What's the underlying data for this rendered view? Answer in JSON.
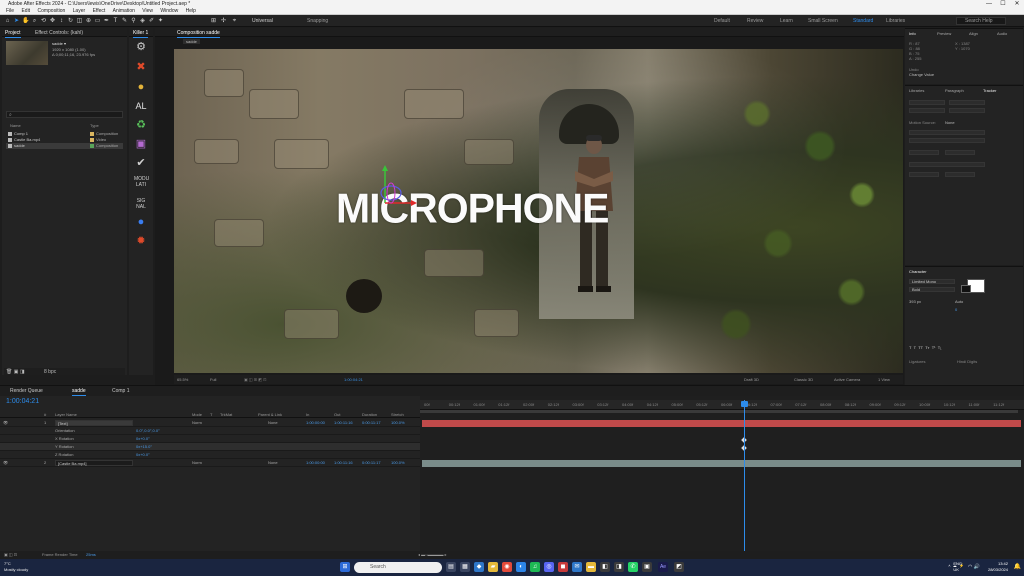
{
  "window": {
    "title": "Adobe After Effects 2024 - C:\\Users\\lewis\\OneDrive\\Desktop\\Untitled Project.aep *",
    "controls": [
      "—",
      "☐",
      "✕"
    ]
  },
  "menu": [
    "File",
    "Edit",
    "Composition",
    "Layer",
    "Effect",
    "Animation",
    "View",
    "Window",
    "Help"
  ],
  "toolbar": {
    "snapping_label": "Snapping",
    "universal_label": "Universal",
    "workspaces": [
      "Default",
      "Review",
      "Learn",
      "Small Screen",
      "Standard",
      "Libraries"
    ],
    "active_workspace": "Standard",
    "search_placeholder": "Search Help"
  },
  "project_panel": {
    "tab": "Project",
    "tab2": "Effect Controls: (kahl)",
    "comp_name": "sadde ▾",
    "comp_info_1": "1920 x 1080 (1.00)",
    "comp_info_2": "Δ 0;00;11;16, 23.976 fps",
    "search_placeholder": "⌕",
    "col_name": "Name",
    "col_label": "Type",
    "items": [
      {
        "name": "Comp 1",
        "label": "Composition",
        "color": "#d9b660"
      },
      {
        "name": "Castle Ba.mp4",
        "label": "Video",
        "color": "#d9b660"
      },
      {
        "name": "sadde",
        "label": "Composition",
        "color": "#5aa55a"
      }
    ],
    "footer_bpc": "8 bpc"
  },
  "effects_strip": {
    "title": "Killer 1",
    "icons": [
      {
        "name": "gear-icon",
        "glyph": "⚙",
        "color": "#cfcfcf"
      },
      {
        "name": "cross-arrows-icon",
        "glyph": "✖",
        "color": "#e04a2a"
      },
      {
        "name": "bulb-icon",
        "glyph": "💡",
        "color": "#e3b33a"
      },
      {
        "name": "al-text-icon",
        "glyph": "AL",
        "color": "#e0e0e0"
      },
      {
        "name": "recycle-icon",
        "glyph": "♻",
        "color": "#59c25b"
      },
      {
        "name": "calendar-icon",
        "glyph": "▣",
        "color": "#b46ad1"
      },
      {
        "name": "check-icon",
        "glyph": "✔",
        "color": "#d0d0d0"
      },
      {
        "name": "modulati-icon",
        "glyph": "MODU LATI",
        "color": "#d0d0d0"
      },
      {
        "name": "signal-icon",
        "glyph": "SIG NAL",
        "color": "#d0d0d0"
      },
      {
        "name": "circle-icon",
        "glyph": "●",
        "color": "#3a7df0"
      },
      {
        "name": "star-icon",
        "glyph": "✹",
        "color": "#e04a2a"
      }
    ]
  },
  "composition": {
    "tab_label": "Composition sadde",
    "breadcrumb": "sadde",
    "text_layer": "MICROPHONE",
    "footer": {
      "zoom": "65.5%",
      "resolution": "Full",
      "timecode": "1:00:04:21",
      "renderer": "Draft 3D",
      "camera": "Classic 3D",
      "view_mode": "Active Camera",
      "views": "1 View"
    }
  },
  "right_panels": {
    "info_tabs": [
      "Info",
      "Preview",
      "Align",
      "Audio"
    ],
    "info_r": "R : 87",
    "info_g": "G : 88",
    "info_b": "B : 75",
    "info_a": "A : 255",
    "info_x": "X : 1387",
    "info_y": "Y : 1070",
    "undo_label": "Undo",
    "undo_value": "Change Value",
    "tracker_tabs": [
      "Libraries",
      "Paragraph",
      "Tracker"
    ],
    "motion_source_label": "Motion Source:",
    "motion_source_value": "None",
    "character_tab": "Character",
    "font_name": "Limited Mono",
    "font_style": "Bold",
    "font_size": "393 px",
    "leading": "Auto",
    "tracking": "0",
    "ligatures_label": "Ligatures",
    "hindi_label": "Hindi Digits"
  },
  "timeline": {
    "tabs": [
      "Render Queue",
      "sadde",
      "Comp 1"
    ],
    "active_tab": "sadde",
    "timecode": "1:00:04:21",
    "columns": [
      "#",
      "Layer Name",
      "Mode",
      "T",
      "TrkMat",
      "Parent & Link",
      "In",
      "Out",
      "Duration",
      "Stretch"
    ],
    "layers": [
      {
        "num": "1",
        "name": "[Text]",
        "mode": "Norm",
        "parent": "None",
        "in": "1:00:00:00",
        "out": "1:00:11:16",
        "dur": "0:00:11:17",
        "stretch": "100.0%",
        "selected": true
      },
      {
        "num": "",
        "name": "Orientation",
        "value": "0.0°,0.0°,0.0°",
        "sub": true
      },
      {
        "num": "",
        "name": "X Rotation",
        "value": "0x+0.0°",
        "sub": true
      },
      {
        "num": "",
        "name": "Y Rotation",
        "value": "0x+15.0°",
        "sub": true,
        "selected": true
      },
      {
        "num": "",
        "name": "Z Rotation",
        "value": "0x+0.0°",
        "sub": true
      },
      {
        "num": "2",
        "name": "[Castle Ba.mp4]",
        "mode": "Norm",
        "parent": "None",
        "in": "1:00:00:00",
        "out": "1:00:11:16",
        "dur": "0:00:11:17",
        "stretch": "100.0%"
      }
    ],
    "ruler_ticks": [
      "00f",
      "00:12f",
      "01:00f",
      "01:12f",
      "02:00f",
      "02:12f",
      "03:00f",
      "03:12f",
      "04:00f",
      "04:12f",
      "05:00f",
      "05:12f",
      "06:00f",
      "06:12f",
      "07:00f",
      "07:12f",
      "08:00f",
      "08:12f",
      "09:00f",
      "09:12f",
      "10:00f",
      "10:12f",
      "11:00f",
      "11:12f"
    ],
    "footer_label": "Frame Render Time",
    "footer_value": "25ms",
    "colors": {
      "text_layer": "#c04a4a",
      "video_layer": "#7a8c8a",
      "playhead": "#2d8ceb"
    }
  },
  "taskbar": {
    "weather_temp": "7°C",
    "weather_desc": "Mostly cloudy",
    "search_placeholder": "Search",
    "lang_1": "ENG",
    "lang_2": "UK",
    "time": "13:42",
    "date": "28/03/2024"
  }
}
